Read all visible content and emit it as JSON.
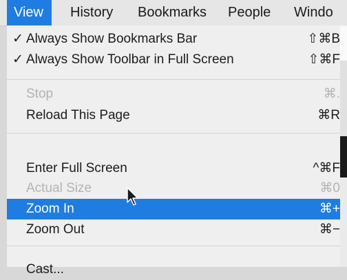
{
  "menubar": {
    "items": [
      "View",
      "History",
      "Bookmarks",
      "People",
      "Windo"
    ],
    "active_index": 0
  },
  "menu": {
    "items": [
      {
        "checked": true,
        "label": "Always Show Bookmarks Bar",
        "shortcut": "⇧⌘B",
        "enabled": true
      },
      {
        "checked": true,
        "label": "Always Show Toolbar in Full Screen",
        "shortcut": "⇧⌘F",
        "enabled": true
      },
      {
        "label": "Stop",
        "shortcut": "⌘.",
        "enabled": false
      },
      {
        "label": "Reload This Page",
        "shortcut": "⌘R",
        "enabled": true
      },
      {
        "label": "Enter Full Screen",
        "shortcut": "^⌘F",
        "enabled": true
      },
      {
        "label": "Actual Size",
        "shortcut": "⌘0",
        "enabled": false
      },
      {
        "label": "Zoom In",
        "shortcut": "⌘+",
        "enabled": true,
        "highlighted": true
      },
      {
        "label": "Zoom Out",
        "shortcut": "⌘−",
        "enabled": true
      },
      {
        "label": "Cast...",
        "shortcut": "",
        "enabled": true
      }
    ]
  },
  "checkmark": "✓",
  "colors": {
    "highlight": "#1f7ce0",
    "disabled_text": "#b3b3b3",
    "menu_bg": "#efefef"
  },
  "icons": {
    "cursor": "arrow-pointer-icon"
  }
}
